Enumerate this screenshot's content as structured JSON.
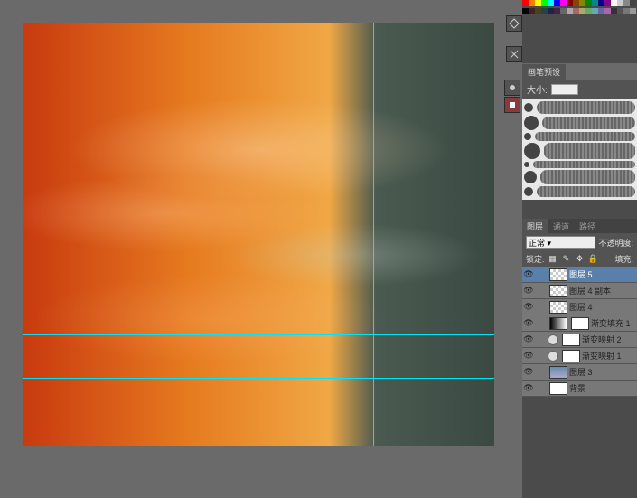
{
  "tools": {
    "color_picker": "color",
    "ruler": "ruler",
    "settings": "settings"
  },
  "brush_panel": {
    "tab": "画笔预设",
    "size_label": "大小:",
    "brushes": [
      1,
      2,
      3,
      4,
      5,
      6,
      7
    ]
  },
  "layers_panel": {
    "tabs": [
      "图层",
      "通道",
      "路径"
    ],
    "blend_mode": "正常",
    "opacity_label": "不透明度:",
    "lock_label": "锁定:",
    "fill_label": "填充:",
    "layers": [
      {
        "name": "图层 5",
        "selected": true,
        "thumb": "checker"
      },
      {
        "name": "图层 4 副本",
        "thumb": "checker"
      },
      {
        "name": "图层 4",
        "thumb": "checker"
      },
      {
        "name": "渐变填充 1",
        "thumb": "grad",
        "adj": true,
        "mask": true
      },
      {
        "name": "渐变映射 2",
        "adj": true,
        "mask": true,
        "dot": true
      },
      {
        "name": "渐变映射 1",
        "adj": true,
        "mask": true,
        "dot": true
      },
      {
        "name": "图层 3",
        "thumb": "sky"
      },
      {
        "name": "背景",
        "thumb": "white"
      }
    ]
  },
  "guides": {
    "v": 388,
    "h1": 345,
    "h2": 393
  }
}
